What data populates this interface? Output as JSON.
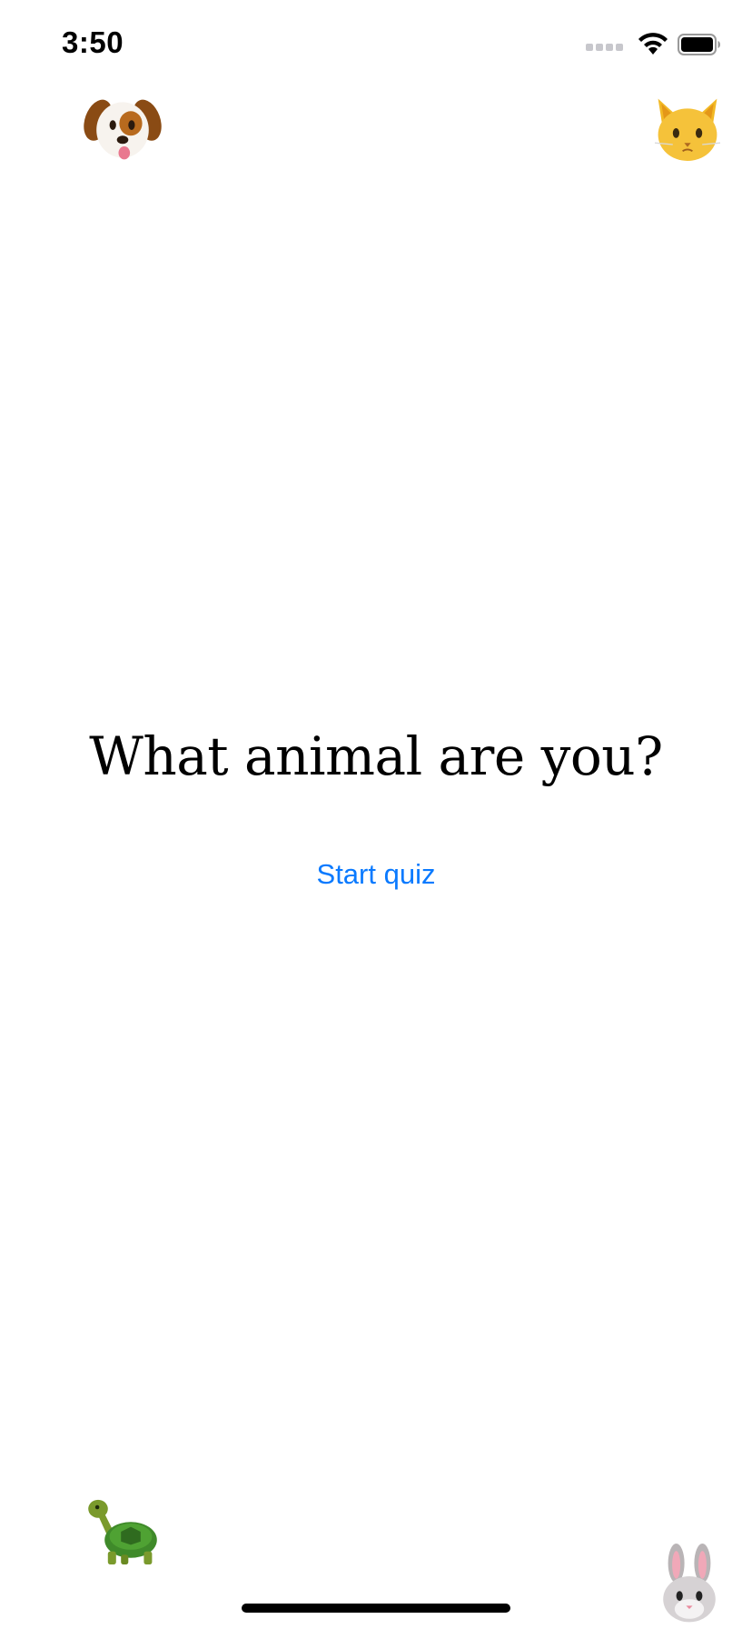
{
  "status_bar": {
    "time": "3:50",
    "icons": [
      "cellular-icon",
      "wifi-icon",
      "battery-icon"
    ]
  },
  "corner_emojis": {
    "top_left": "dog-face-icon",
    "top_right": "cat-face-icon",
    "bottom_left": "turtle-icon",
    "bottom_right": "rabbit-face-icon"
  },
  "main": {
    "title": "What animal are you?",
    "start_label": "Start quiz"
  },
  "colors": {
    "accent": "#0a7aff",
    "background": "#ffffff",
    "text": "#000000"
  }
}
